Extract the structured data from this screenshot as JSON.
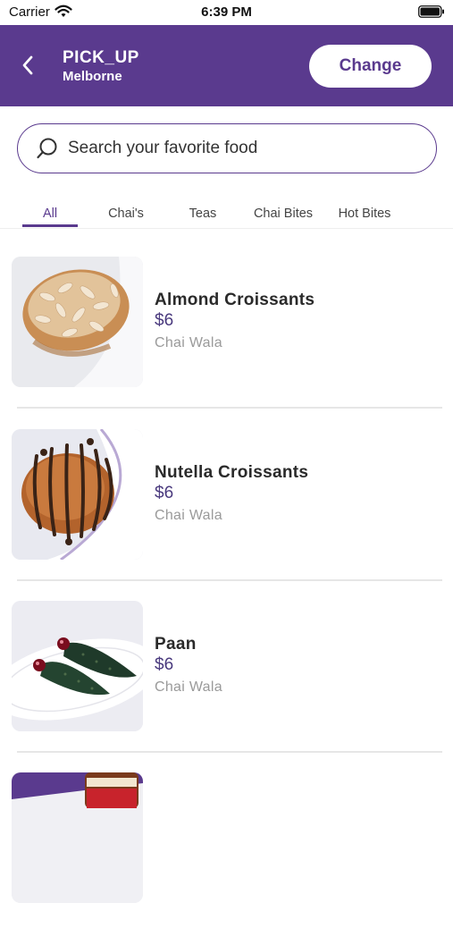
{
  "status_bar": {
    "carrier": "Carrier",
    "time": "6:39 PM"
  },
  "header": {
    "mode": "PICK_UP",
    "location": "Melborne",
    "change_label": "Change",
    "background": "#5a3a8e"
  },
  "search": {
    "placeholder": "Search your favorite food",
    "value": ""
  },
  "tabs": [
    {
      "label": "All",
      "active": true
    },
    {
      "label": "Chai's",
      "active": false
    },
    {
      "label": "Teas",
      "active": false
    },
    {
      "label": "Chai Bites",
      "active": false
    },
    {
      "label": "Hot Bites",
      "active": false
    }
  ],
  "items": [
    {
      "name": "Almond Croissants",
      "price": "$6",
      "vendor": "Chai Wala",
      "image": "almond-croissant-photo"
    },
    {
      "name": "Nutella Croissants",
      "price": "$6",
      "vendor": "Chai Wala",
      "image": "nutella-croissant-photo"
    },
    {
      "name": "Paan",
      "price": "$6",
      "vendor": "Chai Wala",
      "image": "paan-photo"
    },
    {
      "name": "",
      "price": "",
      "vendor": "",
      "image": "nutella-jar-photo"
    }
  ],
  "colors": {
    "accent": "#5a3a8e",
    "price": "#4a3a7e",
    "muted": "#9a9a9a"
  }
}
